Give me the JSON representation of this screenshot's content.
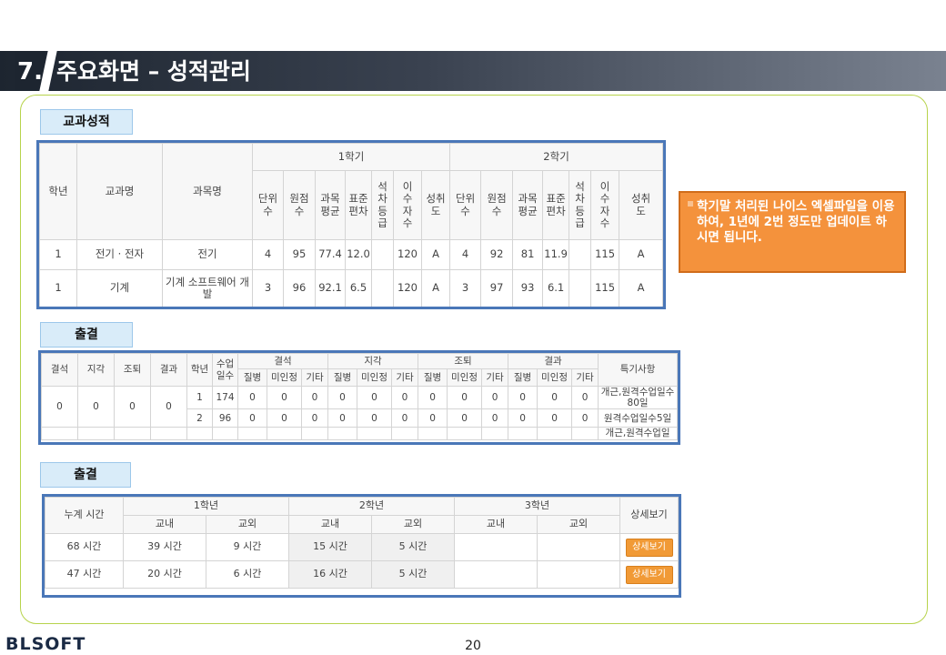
{
  "title": {
    "number": "7.",
    "text": "주요화면 – 성적관리"
  },
  "sections": {
    "grades": "교과성적",
    "attendance": "출결",
    "attendance2": "출결"
  },
  "grades": {
    "headers": {
      "grade": "학년",
      "subject_group": "교과명",
      "subject": "과목명",
      "sem1": "1학기",
      "sem2": "2학기"
    },
    "sub_headers": [
      "단위\n수",
      "원점\n수",
      "과목\n평균",
      "표준\n편차",
      "석\n차\n등\n급",
      "이\n수\n자\n수",
      "성취\n도"
    ],
    "rows": [
      {
        "grade": "1",
        "group": "전기 · 전자",
        "subject": "전기",
        "s1": [
          "4",
          "95",
          "77.4",
          "12.0",
          "",
          "120",
          "A"
        ],
        "s2": [
          "4",
          "92",
          "81",
          "11.9",
          "",
          "115",
          "A"
        ]
      },
      {
        "grade": "1",
        "group": "기계",
        "subject": "기계 소프트웨어 개발",
        "s1": [
          "3",
          "96",
          "92.1",
          "6.5",
          "",
          "120",
          "A"
        ],
        "s2": [
          "3",
          "97",
          "93",
          "6.1",
          "",
          "115",
          "A"
        ]
      }
    ]
  },
  "note": {
    "text": "학기말 처리된 나이스 엑셀파일을 이용하여, 1년에 2번 정도만 업데이트 하시면 됩니다."
  },
  "attendance": {
    "headers": {
      "absent": "결석",
      "late": "지각",
      "early": "조퇴",
      "skip": "결과",
      "grade": "학년",
      "days": "수업\n일수",
      "remarks": "특기사항"
    },
    "group_headers": [
      "결석",
      "지각",
      "조퇴",
      "결과"
    ],
    "sub_headers": [
      "질병",
      "미인정",
      "기타"
    ],
    "summary": [
      "0",
      "0",
      "0",
      "0"
    ],
    "rows": [
      {
        "grade": "1",
        "days": "174",
        "vals": [
          "0",
          "0",
          "0",
          "0",
          "0",
          "0",
          "0",
          "0",
          "0",
          "0",
          "0",
          "0"
        ],
        "remarks": "개근,원격수업일수80일"
      },
      {
        "grade": "2",
        "days": "96",
        "vals": [
          "0",
          "0",
          "0",
          "0",
          "0",
          "0",
          "0",
          "0",
          "0",
          "0",
          "0",
          "0"
        ],
        "remarks": "원격수업일수5일"
      }
    ],
    "cut_remark": "개근,원격수업일"
  },
  "volunteer": {
    "headers": {
      "total": "누계 시간",
      "y1": "1학년",
      "y2": "2학년",
      "y3": "3학년",
      "detail": "상세보기"
    },
    "sub": {
      "in": "교내",
      "out": "교외"
    },
    "rows": [
      {
        "total": "68 시간",
        "y1in": "39 시간",
        "y1out": "9 시간",
        "y2in": "15 시간",
        "y2out": "5 시간",
        "y3in": "",
        "y3out": "",
        "btn": "상세보기"
      },
      {
        "total": "47 시간",
        "y1in": "20 시간",
        "y1out": "6 시간",
        "y2in": "16 시간",
        "y2out": "5 시간",
        "y3in": "",
        "y3out": "",
        "btn": "상세보기"
      }
    ]
  },
  "footer": {
    "logo": "BLSOFT",
    "page": "20"
  }
}
